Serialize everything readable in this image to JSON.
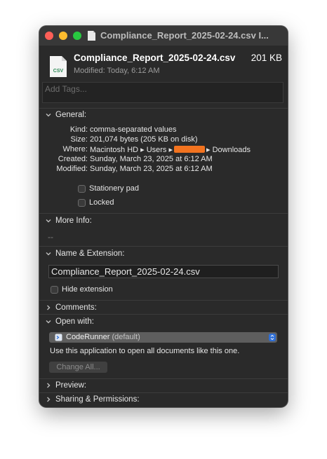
{
  "window": {
    "title": "Compliance_Report_2025-02-24.csv I..."
  },
  "header": {
    "icon_label": "CSV",
    "file_name": "Compliance_Report_2025-02-24.csv",
    "file_size": "201 KB",
    "modified": "Modified: Today, 6:12 AM"
  },
  "tags": {
    "placeholder": "Add Tags..."
  },
  "general": {
    "label": "General:",
    "expanded": true,
    "kind_label": "Kind:",
    "kind_value": "comma-separated values",
    "size_label": "Size:",
    "size_value": "201,074 bytes (205 KB on disk)",
    "where_label": "Where:",
    "where_part1": "Macintosh HD ▸ Users ▸",
    "where_part2": "▸ Downloads",
    "created_label": "Created:",
    "created_value": "Sunday, March 23, 2025 at 6:12 AM",
    "modified_label": "Modified:",
    "modified_value": "Sunday, March 23, 2025 at 6:12 AM",
    "stationery_label": "Stationery pad",
    "stationery_checked": false,
    "locked_label": "Locked",
    "locked_checked": false
  },
  "more_info": {
    "label": "More Info:",
    "expanded": true,
    "value": "--"
  },
  "name_ext": {
    "label": "Name & Extension:",
    "expanded": true,
    "name_value": "Compliance_Report_2025-02-24.csv",
    "hide_ext_label": "Hide extension",
    "hide_ext_checked": false
  },
  "comments": {
    "label": "Comments:",
    "expanded": false
  },
  "open_with": {
    "label": "Open with:",
    "expanded": true,
    "app_name": "CodeRunner",
    "app_suffix": "(default)",
    "description": "Use this application to open all documents like this one.",
    "change_all_label": "Change All..."
  },
  "preview": {
    "label": "Preview:",
    "expanded": false
  },
  "sharing": {
    "label": "Sharing & Permissions:",
    "expanded": false
  },
  "colors": {
    "window_bg": "#2a2a2a",
    "titlebar_bg": "#383838",
    "close": "#fe5f57",
    "minimize": "#febc2e",
    "maximize": "#28c840",
    "redaction": "#f2731f",
    "select_accent": "#2f6fd6"
  }
}
